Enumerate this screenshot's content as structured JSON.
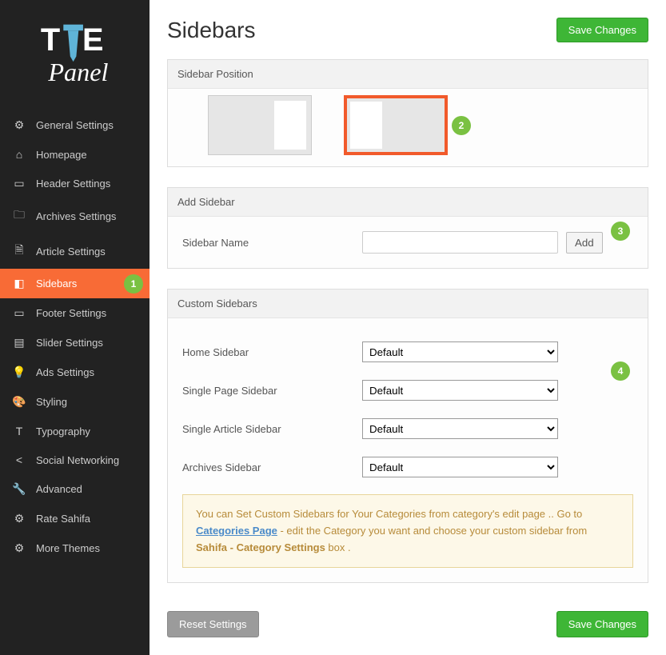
{
  "sidebar": {
    "items": [
      {
        "label": "General Settings"
      },
      {
        "label": "Homepage"
      },
      {
        "label": "Header Settings"
      },
      {
        "label": "Archives Settings"
      },
      {
        "label": "Article Settings"
      },
      {
        "label": "Sidebars"
      },
      {
        "label": "Footer Settings"
      },
      {
        "label": "Slider Settings"
      },
      {
        "label": "Ads Settings"
      },
      {
        "label": "Styling"
      },
      {
        "label": "Typography"
      },
      {
        "label": "Social Networking"
      },
      {
        "label": "Advanced"
      },
      {
        "label": "Rate Sahifa"
      },
      {
        "label": "More Themes"
      }
    ]
  },
  "header": {
    "title": "Sidebars",
    "save_label": "Save Changes"
  },
  "annotations": {
    "a1": "1",
    "a2": "2",
    "a3": "3",
    "a4": "4"
  },
  "position_panel": {
    "title": "Sidebar Position"
  },
  "add_panel": {
    "title": "Add Sidebar",
    "label": "Sidebar Name",
    "value": "",
    "add_btn": "Add"
  },
  "custom_panel": {
    "title": "Custom Sidebars",
    "rows": [
      {
        "label": "Home Sidebar",
        "value": "Default"
      },
      {
        "label": "Single Page Sidebar",
        "value": "Default"
      },
      {
        "label": "Single Article Sidebar",
        "value": "Default"
      },
      {
        "label": "Archives Sidebar",
        "value": "Default"
      }
    ],
    "notice_pre": "You can Set Custom Sidebars for Your Categories from category's edit page .. Go to ",
    "notice_link": "Categories Page",
    "notice_mid": " - edit the Category you want and choose your custom sidebar from ",
    "notice_bold": "Sahifa - Category Settings",
    "notice_post": " box ."
  },
  "footer": {
    "reset_label": "Reset Settings",
    "save_label": "Save Changes"
  }
}
